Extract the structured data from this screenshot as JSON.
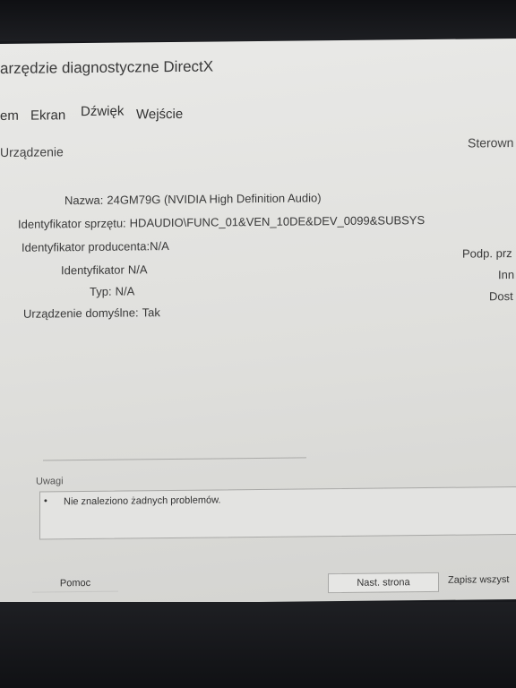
{
  "window": {
    "title": "arzędzie diagnostyczne DirectX"
  },
  "tabs": [
    {
      "label": "em"
    },
    {
      "label": "Ekran"
    },
    {
      "label": "Dźwięk"
    },
    {
      "label": "Wejście"
    }
  ],
  "device": {
    "section_label": "Urządzenie",
    "fields": [
      {
        "label": "Nazwa:",
        "value": "24GM79G (NVIDIA High Definition Audio)"
      },
      {
        "label": "Identyfikator sprzętu:",
        "value": "HDAUDIO\\FUNC_01&VEN_10DE&DEV_0099&SUBSYS"
      },
      {
        "label": "Identyfikator producenta:",
        "value": "N/A"
      },
      {
        "label": "Identyfikator",
        "value": "N/A"
      },
      {
        "label": "Typ:",
        "value": "N/A"
      },
      {
        "label": "Urządzenie domyślne:",
        "value": "Tak"
      }
    ]
  },
  "drivers": {
    "section_label": "Sterown",
    "fields": [
      {
        "label": "Podp. prz"
      },
      {
        "label": "Inn"
      },
      {
        "label": "Dost"
      }
    ]
  },
  "notes": {
    "label": "Uwagi",
    "items": [
      "Nie znaleziono żadnych problemów."
    ]
  },
  "buttons": {
    "help": "Pomoc",
    "next_page": "Nast. strona",
    "save_all": "Zapisz wszyst"
  }
}
